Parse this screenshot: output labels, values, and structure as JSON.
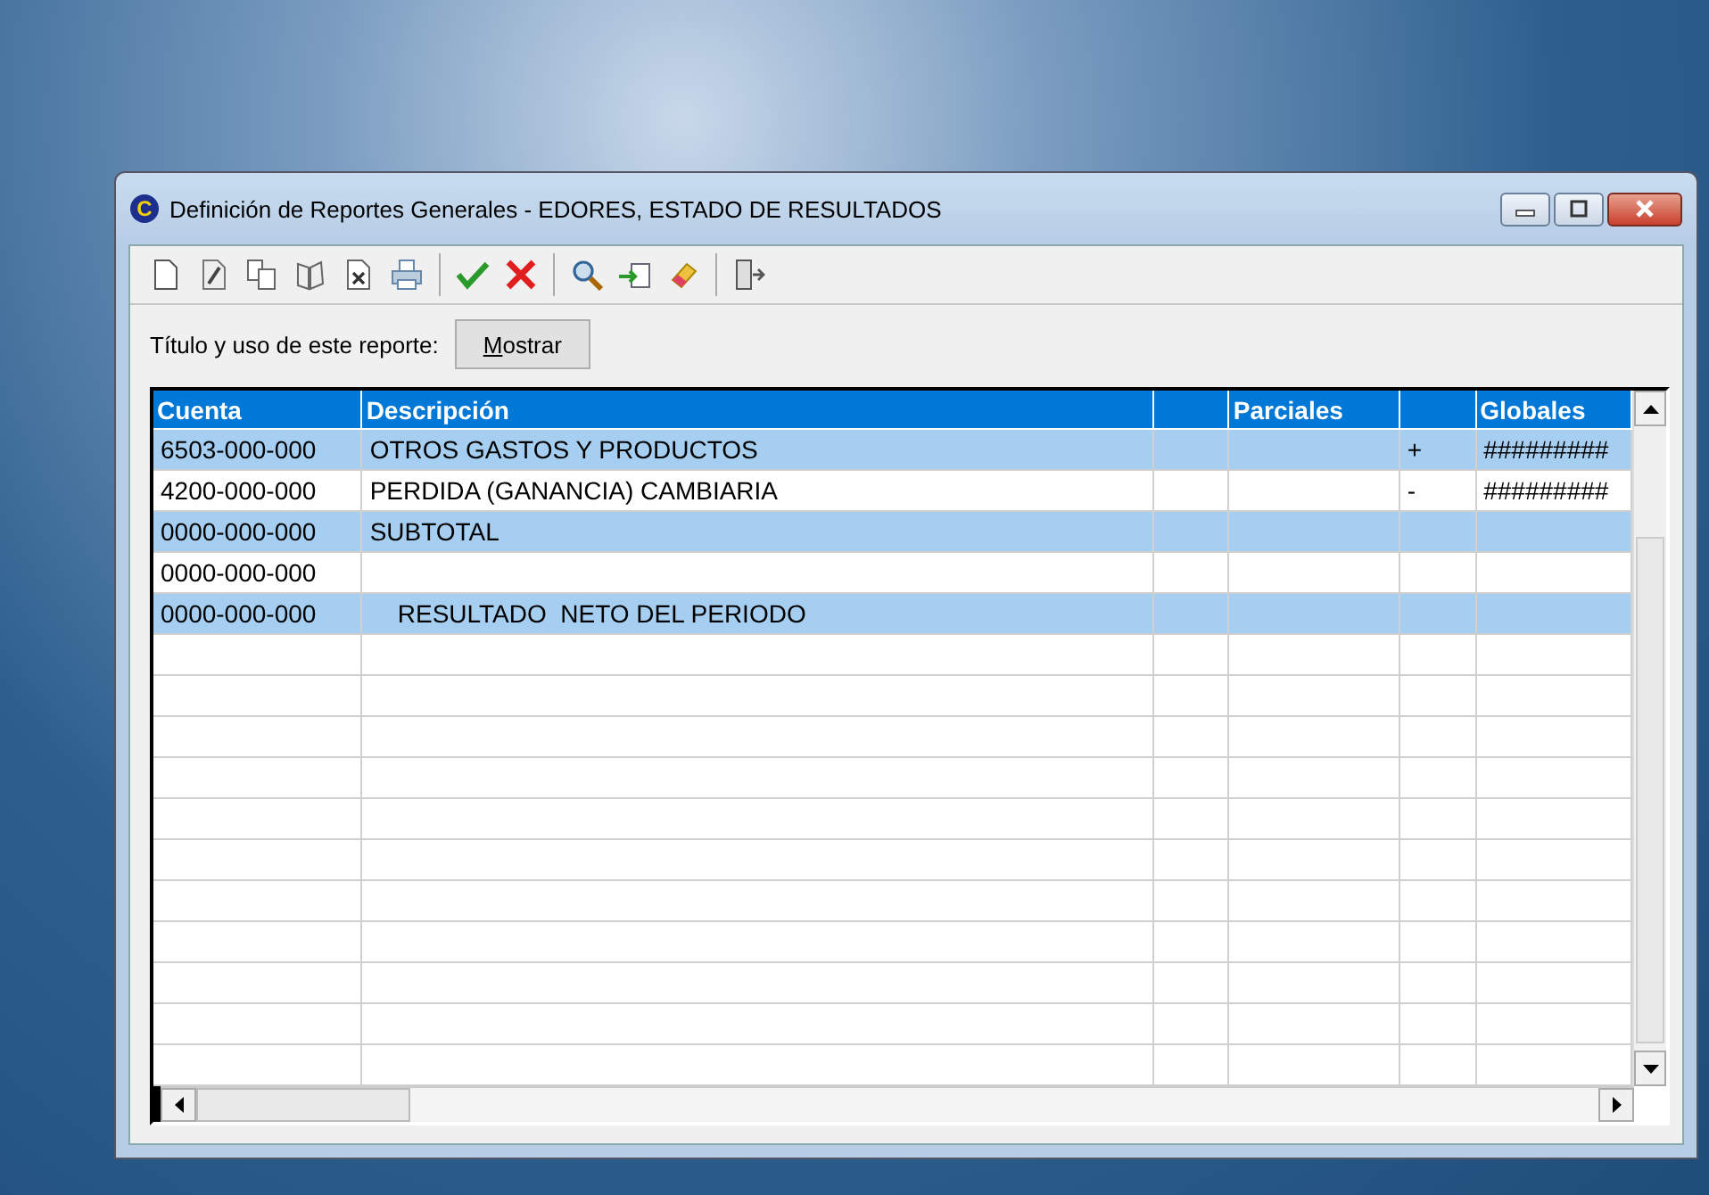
{
  "window": {
    "app_icon_letter": "C",
    "title": "Definición de Reportes Generales - EDORES, ESTADO DE RESULTADOS"
  },
  "toolbar": [
    {
      "kind": "new"
    },
    {
      "kind": "edit"
    },
    {
      "kind": "copy"
    },
    {
      "kind": "book"
    },
    {
      "kind": "delete"
    },
    {
      "kind": "print"
    },
    {
      "kind": "sep"
    },
    {
      "kind": "accept"
    },
    {
      "kind": "cancel"
    },
    {
      "kind": "sep"
    },
    {
      "kind": "search"
    },
    {
      "kind": "import"
    },
    {
      "kind": "erase"
    },
    {
      "kind": "sep"
    },
    {
      "kind": "exit"
    }
  ],
  "report_label": "Título y uso de este reporte:",
  "show_button": "Mostrar",
  "table": {
    "columns": [
      "Cuenta",
      "Descripción",
      "",
      "Parciales",
      "",
      "Globales"
    ],
    "rows": [
      {
        "shaded": true,
        "cells": [
          "6503-000-000",
          "OTROS GASTOS Y PRODUCTOS",
          "",
          "",
          "+",
          "#########"
        ]
      },
      {
        "shaded": false,
        "cells": [
          "4200-000-000",
          "PERDIDA (GANANCIA) CAMBIARIA",
          "",
          "",
          "-",
          "#########"
        ]
      },
      {
        "shaded": true,
        "cells": [
          "0000-000-000",
          "SUBTOTAL",
          "",
          "",
          "",
          ""
        ]
      },
      {
        "shaded": false,
        "cells": [
          "0000-000-000",
          "",
          "",
          "",
          "",
          ""
        ]
      },
      {
        "shaded": true,
        "cells": [
          "0000-000-000",
          "    RESULTADO  NETO DEL PERIODO",
          "",
          "",
          "",
          ""
        ]
      }
    ]
  }
}
